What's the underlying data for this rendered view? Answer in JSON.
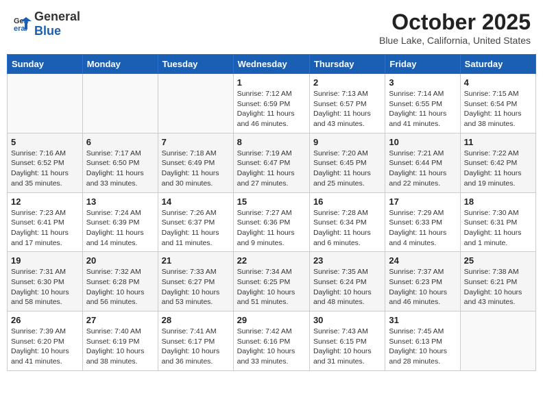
{
  "header": {
    "logo_general": "General",
    "logo_blue": "Blue",
    "month_title": "October 2025",
    "location": "Blue Lake, California, United States"
  },
  "weekdays": [
    "Sunday",
    "Monday",
    "Tuesday",
    "Wednesday",
    "Thursday",
    "Friday",
    "Saturday"
  ],
  "weeks": [
    [
      {
        "day": "",
        "info": ""
      },
      {
        "day": "",
        "info": ""
      },
      {
        "day": "",
        "info": ""
      },
      {
        "day": "1",
        "info": "Sunrise: 7:12 AM\nSunset: 6:59 PM\nDaylight: 11 hours and 46 minutes."
      },
      {
        "day": "2",
        "info": "Sunrise: 7:13 AM\nSunset: 6:57 PM\nDaylight: 11 hours and 43 minutes."
      },
      {
        "day": "3",
        "info": "Sunrise: 7:14 AM\nSunset: 6:55 PM\nDaylight: 11 hours and 41 minutes."
      },
      {
        "day": "4",
        "info": "Sunrise: 7:15 AM\nSunset: 6:54 PM\nDaylight: 11 hours and 38 minutes."
      }
    ],
    [
      {
        "day": "5",
        "info": "Sunrise: 7:16 AM\nSunset: 6:52 PM\nDaylight: 11 hours and 35 minutes."
      },
      {
        "day": "6",
        "info": "Sunrise: 7:17 AM\nSunset: 6:50 PM\nDaylight: 11 hours and 33 minutes."
      },
      {
        "day": "7",
        "info": "Sunrise: 7:18 AM\nSunset: 6:49 PM\nDaylight: 11 hours and 30 minutes."
      },
      {
        "day": "8",
        "info": "Sunrise: 7:19 AM\nSunset: 6:47 PM\nDaylight: 11 hours and 27 minutes."
      },
      {
        "day": "9",
        "info": "Sunrise: 7:20 AM\nSunset: 6:45 PM\nDaylight: 11 hours and 25 minutes."
      },
      {
        "day": "10",
        "info": "Sunrise: 7:21 AM\nSunset: 6:44 PM\nDaylight: 11 hours and 22 minutes."
      },
      {
        "day": "11",
        "info": "Sunrise: 7:22 AM\nSunset: 6:42 PM\nDaylight: 11 hours and 19 minutes."
      }
    ],
    [
      {
        "day": "12",
        "info": "Sunrise: 7:23 AM\nSunset: 6:41 PM\nDaylight: 11 hours and 17 minutes."
      },
      {
        "day": "13",
        "info": "Sunrise: 7:24 AM\nSunset: 6:39 PM\nDaylight: 11 hours and 14 minutes."
      },
      {
        "day": "14",
        "info": "Sunrise: 7:26 AM\nSunset: 6:37 PM\nDaylight: 11 hours and 11 minutes."
      },
      {
        "day": "15",
        "info": "Sunrise: 7:27 AM\nSunset: 6:36 PM\nDaylight: 11 hours and 9 minutes."
      },
      {
        "day": "16",
        "info": "Sunrise: 7:28 AM\nSunset: 6:34 PM\nDaylight: 11 hours and 6 minutes."
      },
      {
        "day": "17",
        "info": "Sunrise: 7:29 AM\nSunset: 6:33 PM\nDaylight: 11 hours and 4 minutes."
      },
      {
        "day": "18",
        "info": "Sunrise: 7:30 AM\nSunset: 6:31 PM\nDaylight: 11 hours and 1 minute."
      }
    ],
    [
      {
        "day": "19",
        "info": "Sunrise: 7:31 AM\nSunset: 6:30 PM\nDaylight: 10 hours and 58 minutes."
      },
      {
        "day": "20",
        "info": "Sunrise: 7:32 AM\nSunset: 6:28 PM\nDaylight: 10 hours and 56 minutes."
      },
      {
        "day": "21",
        "info": "Sunrise: 7:33 AM\nSunset: 6:27 PM\nDaylight: 10 hours and 53 minutes."
      },
      {
        "day": "22",
        "info": "Sunrise: 7:34 AM\nSunset: 6:25 PM\nDaylight: 10 hours and 51 minutes."
      },
      {
        "day": "23",
        "info": "Sunrise: 7:35 AM\nSunset: 6:24 PM\nDaylight: 10 hours and 48 minutes."
      },
      {
        "day": "24",
        "info": "Sunrise: 7:37 AM\nSunset: 6:23 PM\nDaylight: 10 hours and 46 minutes."
      },
      {
        "day": "25",
        "info": "Sunrise: 7:38 AM\nSunset: 6:21 PM\nDaylight: 10 hours and 43 minutes."
      }
    ],
    [
      {
        "day": "26",
        "info": "Sunrise: 7:39 AM\nSunset: 6:20 PM\nDaylight: 10 hours and 41 minutes."
      },
      {
        "day": "27",
        "info": "Sunrise: 7:40 AM\nSunset: 6:19 PM\nDaylight: 10 hours and 38 minutes."
      },
      {
        "day": "28",
        "info": "Sunrise: 7:41 AM\nSunset: 6:17 PM\nDaylight: 10 hours and 36 minutes."
      },
      {
        "day": "29",
        "info": "Sunrise: 7:42 AM\nSunset: 6:16 PM\nDaylight: 10 hours and 33 minutes."
      },
      {
        "day": "30",
        "info": "Sunrise: 7:43 AM\nSunset: 6:15 PM\nDaylight: 10 hours and 31 minutes."
      },
      {
        "day": "31",
        "info": "Sunrise: 7:45 AM\nSunset: 6:13 PM\nDaylight: 10 hours and 28 minutes."
      },
      {
        "day": "",
        "info": ""
      }
    ]
  ]
}
